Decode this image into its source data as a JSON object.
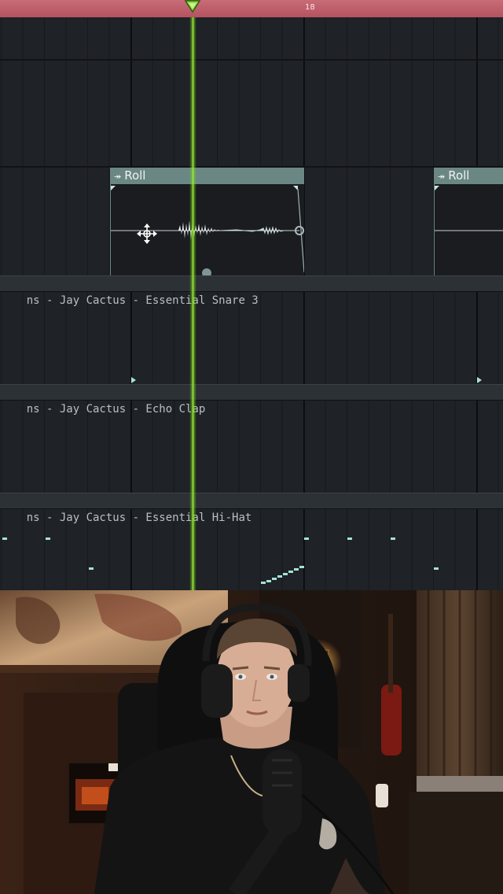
{
  "timeline": {
    "bar_number": "18"
  },
  "tracks": [
    {
      "name": "ns - Jay Cactus - Essential Snare 3"
    },
    {
      "name": "ns - Jay Cactus - Echo Clap"
    },
    {
      "name": "ns - Jay Cactus - Essential Hi-Hat"
    }
  ],
  "clips": [
    {
      "label": "Roll"
    },
    {
      "label": "Roll"
    }
  ],
  "colors": {
    "timeline": "#c0606c",
    "playhead": "#a4f03e",
    "clip_header": "#6a8784",
    "notes": "#a7e2d5"
  },
  "icons": {
    "playhead_marker": "playhead-marker-icon",
    "move_cursor": "move-cursor-icon",
    "roll_clip": "roll-clip-icon"
  }
}
